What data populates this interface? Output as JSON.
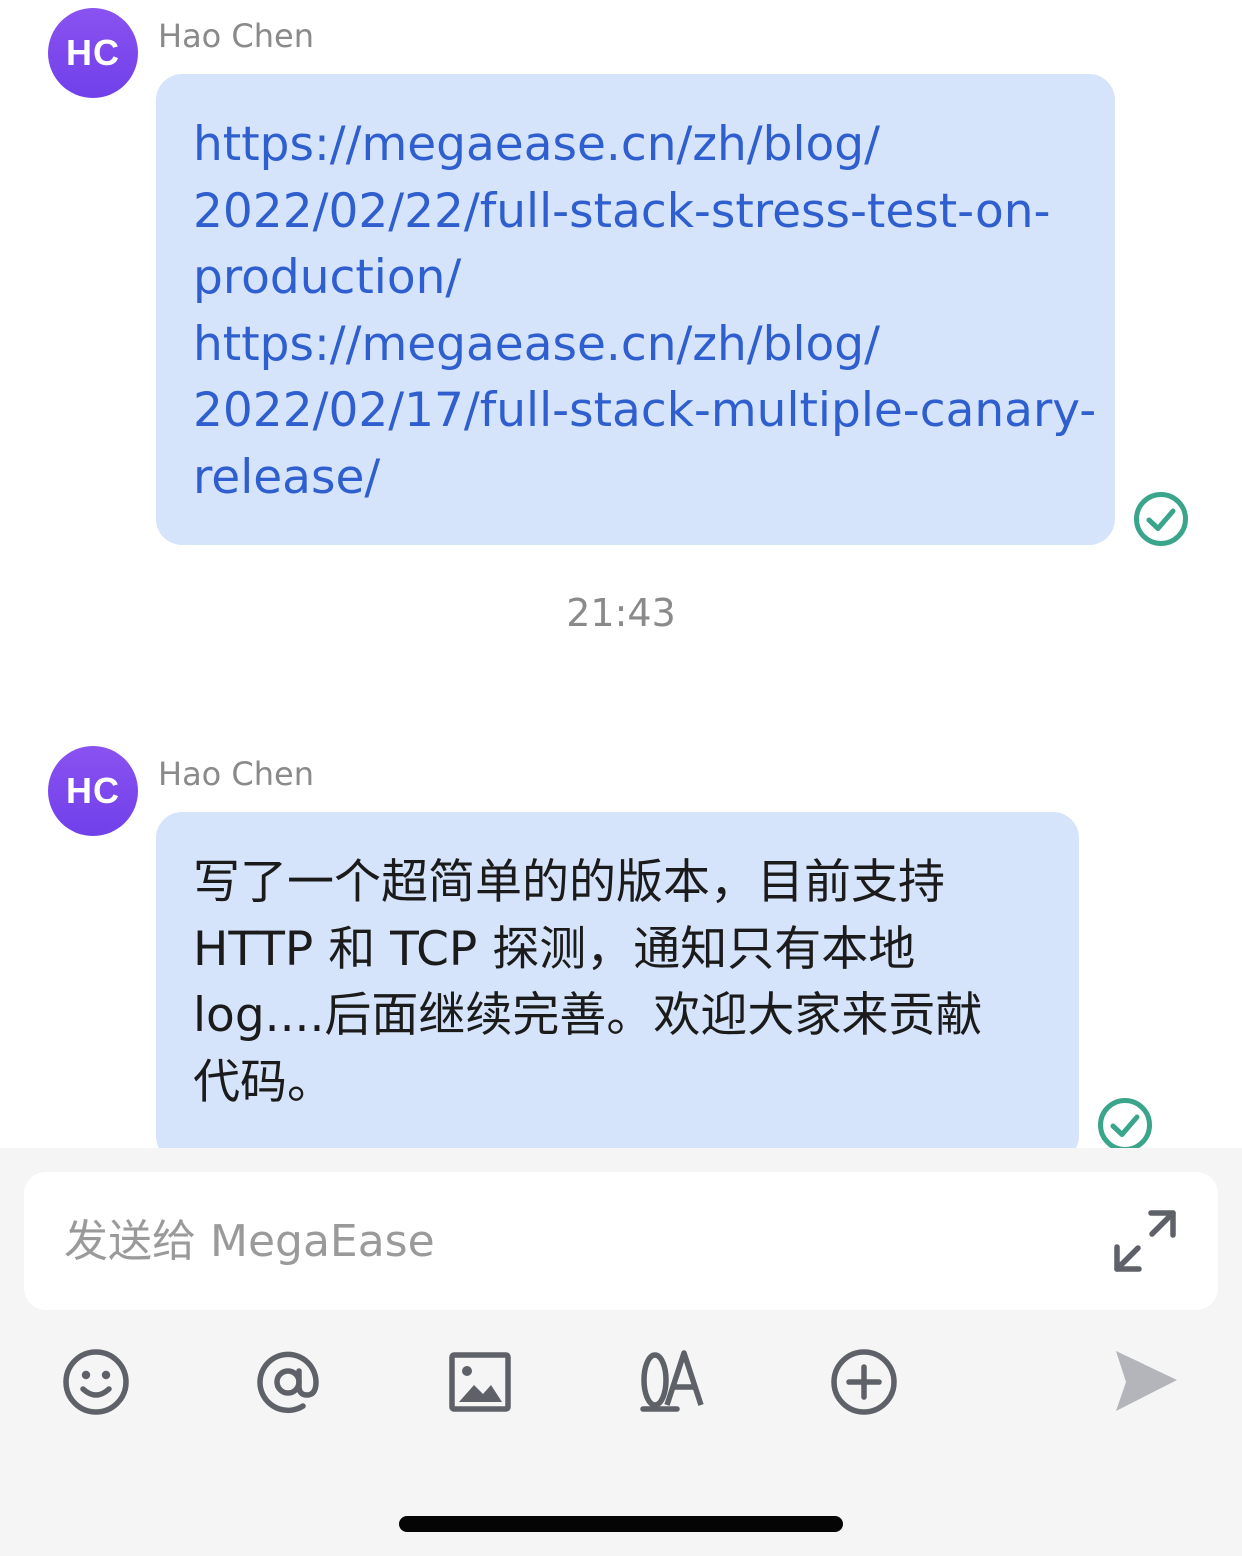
{
  "conversation": {
    "messages": [
      {
        "avatar_initials": "HC",
        "sender": "Hao Chen",
        "lines": [
          "https://megaease.cn/zh/blog/",
          "2022/02/22/full-stack-stress-test-on-",
          "production/",
          "https://megaease.cn/zh/blog/",
          "2022/02/17/full-stack-multiple-canary-",
          "release/"
        ],
        "status_icon": "read-check-icon"
      },
      {
        "avatar_initials": "HC",
        "sender": "Hao Chen",
        "lines": [
          "写了一个超简单的的版本，目前支持",
          "HTTP 和 TCP 探测，通知只有本地",
          "log....后面继续完善。欢迎大家来贡献",
          "代码。"
        ],
        "status_icon": "read-check-icon"
      }
    ],
    "timestamp": "21:43"
  },
  "composer": {
    "placeholder": "发送给 MegaEase",
    "expand_icon": "expand-icon",
    "toolbar": [
      "emoji-icon",
      "mention-icon",
      "image-icon",
      "oa-icon",
      "add-icon",
      "send-icon"
    ]
  },
  "colors": {
    "avatar": "#7a48ee",
    "bubble": "#d6e4fb",
    "link": "#2f5fce",
    "check": "#3aa58b",
    "icon": "#5f6168",
    "send_disabled": "#b3b5ba",
    "composer_bg": "#f5f5f5"
  }
}
